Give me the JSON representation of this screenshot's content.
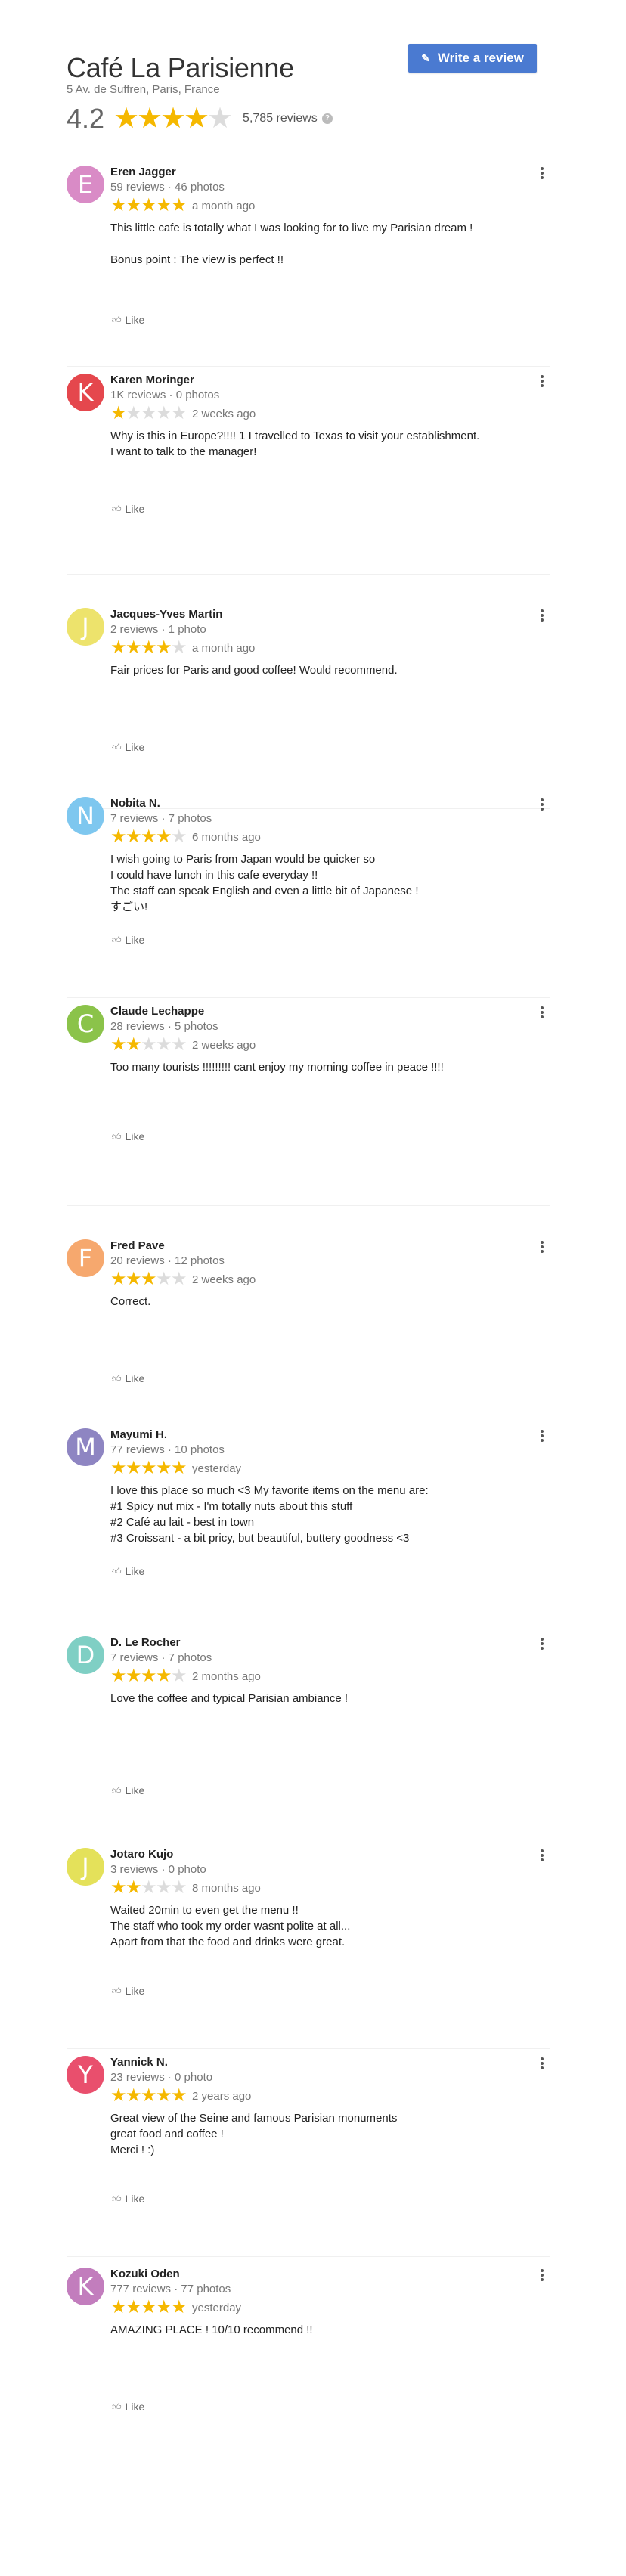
{
  "header": {
    "title": "Café La Parisienne",
    "address": "5 Av. de Suffren, Paris, France",
    "rating": "4.2",
    "rating_stars": 4,
    "review_count": "5,785 reviews",
    "write_review_label": "Write a review"
  },
  "colors": {
    "star_filled": "#f5b800",
    "star_empty": "#dcdcdc",
    "button": "#4a7ad1"
  },
  "reviews": [
    {
      "initial": "E",
      "avatar_color": "#d98bc6",
      "name": "Eren Jagger",
      "meta": "59 reviews · 46 photos",
      "stars": 5,
      "date": "a month ago",
      "lines": [
        "This little cafe is totally what I was looking for to live my Parisian dream !",
        "",
        "Bonus point : The view is perfect !!"
      ],
      "like": "Like"
    },
    {
      "initial": "K",
      "avatar_color": "#e5474d",
      "name": "Karen Moringer",
      "meta": "1K reviews · 0 photos",
      "stars": 1,
      "date": "2 weeks ago",
      "lines": [
        "Why is this in Europe?!!!! 1  I travelled to Texas to visit your establishment.",
        "I want to talk to the manager!"
      ],
      "like": "Like"
    },
    {
      "initial": "J",
      "avatar_color": "#ede36c",
      "name": "Jacques-Yves Martin",
      "meta": "2 reviews · 1 photo",
      "stars": 4,
      "date": "a month ago",
      "lines": [
        "Fair prices for Paris and good coffee! Would recommend."
      ],
      "like": "Like"
    },
    {
      "initial": "N",
      "avatar_color": "#7ec7ef",
      "name": "Nobita N.",
      "meta": "7 reviews · 7 photos",
      "stars": 4,
      "date": "6 months ago",
      "lines": [
        "I wish going to Paris from Japan would be quicker so",
        "I could have lunch in this cafe everyday !!",
        "The staff can speak English and even a little bit of Japanese !",
        "すごい!"
      ],
      "like": "Like"
    },
    {
      "initial": "C",
      "avatar_color": "#8bc34a",
      "name": "Claude Lechappe",
      "meta": "28 reviews · 5 photos",
      "stars": 2,
      "date": "2 weeks ago",
      "lines": [
        "Too many tourists !!!!!!!!! cant enjoy my morning coffee in peace !!!!"
      ],
      "like": "Like"
    },
    {
      "initial": "F",
      "avatar_color": "#f6a86e",
      "name": "Fred Pave",
      "meta": "20 reviews · 12 photos",
      "stars": 3,
      "date": "2 weeks ago",
      "lines": [
        "Correct."
      ],
      "like": "Like"
    },
    {
      "initial": "M",
      "avatar_color": "#8e85c2",
      "name": "Mayumi H.",
      "meta": "77 reviews · 10 photos",
      "stars": 5,
      "date": "yesterday",
      "lines": [
        "I love this place so much <3 My favorite items on the menu are:",
        "#1 Spicy nut mix - I'm totally nuts about this stuff",
        "#2 Café au lait - best in town",
        "#3 Croissant - a bit pricy, but beautiful, buttery goodness <3"
      ],
      "like": "Like"
    },
    {
      "initial": "D",
      "avatar_color": "#7fcfc4",
      "name": "D. Le Rocher",
      "meta": "7 reviews · 7 photos",
      "stars": 4,
      "date": "2 months ago",
      "lines": [
        "Love the coffee and typical Parisian ambiance !"
      ],
      "like": "Like"
    },
    {
      "initial": "J",
      "avatar_color": "#e4e15a",
      "name": "Jotaro Kujo",
      "meta": "3 reviews · 0 photo",
      "stars": 2,
      "date": "8 months ago",
      "lines": [
        "Waited 20min to even get the menu !!",
        "The staff who took my order wasnt polite at all...",
        "Apart from that the food and drinks were great."
      ],
      "like": "Like"
    },
    {
      "initial": "Y",
      "avatar_color": "#e94f6d",
      "name": "Yannick N.",
      "meta": "23 reviews · 0 photo",
      "stars": 5,
      "date": "2 years ago",
      "lines": [
        "Great view of the Seine and famous Parisian monuments",
        "great food and coffee !",
        "Merci ! :)"
      ],
      "like": "Like"
    },
    {
      "initial": "K",
      "avatar_color": "#c27dbd",
      "name": "Kozuki Oden",
      "meta": "777 reviews · 77 photos",
      "stars": 5,
      "date": "yesterday",
      "lines": [
        "AMAZING PLACE ! 10/10 recommend !!"
      ],
      "like": "Like"
    }
  ]
}
